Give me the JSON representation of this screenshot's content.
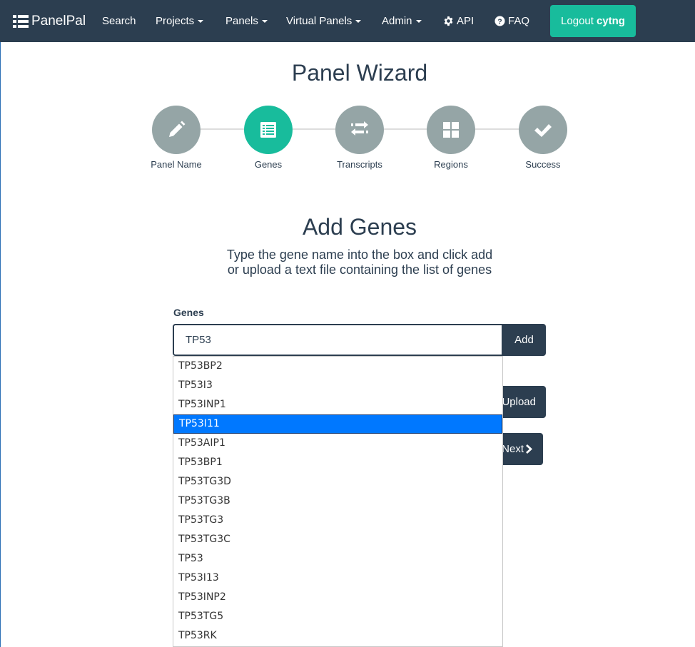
{
  "navbar": {
    "brand": "PanelPal",
    "items": [
      {
        "label": "Search",
        "dropdown": false
      },
      {
        "label": "Projects",
        "dropdown": true
      },
      {
        "label": "Panels",
        "dropdown": true
      },
      {
        "label": "Virtual Panels",
        "dropdown": true
      },
      {
        "label": "Admin",
        "dropdown": true
      },
      {
        "label": "API",
        "icon": "gear-icon"
      },
      {
        "label": "FAQ",
        "icon": "question-circle-icon"
      }
    ],
    "logout_label": "Logout",
    "username": "cytng"
  },
  "page_title": "Panel Wizard",
  "wizard": {
    "steps": [
      {
        "label": "Panel Name",
        "icon": "pencil-icon",
        "active": false
      },
      {
        "label": "Genes",
        "icon": "list-icon",
        "active": true
      },
      {
        "label": "Transcripts",
        "icon": "exchange-icon",
        "active": false
      },
      {
        "label": "Regions",
        "icon": "grid-icon",
        "active": false
      },
      {
        "label": "Success",
        "icon": "check-icon",
        "active": false
      }
    ]
  },
  "section": {
    "title": "Add Genes",
    "description_line1": "Type the gene name into the box and click add",
    "description_line2": "or upload a text file containing the list of genes"
  },
  "form": {
    "genes_label": "Genes",
    "gene_input_value": "TP53",
    "add_label": "Add",
    "upload_label": "Upload",
    "next_label": "Next"
  },
  "autocomplete": {
    "selected": "TP53I11",
    "items": [
      "TP53BP2",
      "TP53I3",
      "TP53INP1",
      "TP53I11",
      "TP53AIP1",
      "TP53BP1",
      "TP53TG3D",
      "TP53TG3B",
      "TP53TG3",
      "TP53TG3C",
      "TP53",
      "TP53I13",
      "TP53INP2",
      "TP53TG5",
      "TP53RK"
    ]
  },
  "colors": {
    "navbar": "#2c3e50",
    "accent": "#18bc9c",
    "step_inactive": "#95a5a6",
    "selection": "#0078ff"
  }
}
